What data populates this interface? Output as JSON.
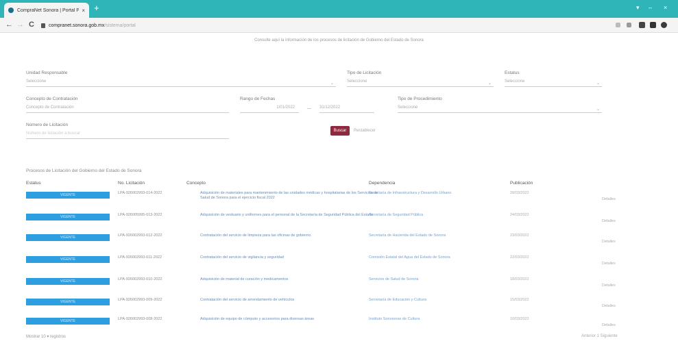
{
  "browser": {
    "tab_title": "CompraNet Sonora | Portal Públ",
    "tab_close": "×",
    "new_tab": "+",
    "win_min": "▾",
    "win_restore": "–",
    "win_close": "×",
    "back": "←",
    "forward": "→",
    "reload": "C",
    "url_host": "compranet.sonora.gob.mx",
    "url_path": "/sistema/portal"
  },
  "page": {
    "banner": "Consulte aquí la información de los procesos de licitación de Gobierno del Estado de Sonora"
  },
  "filters": {
    "unidad_label": "Unidad Responsable",
    "unidad_value": "Seleccione",
    "tipo_label": "Tipo de Licitación",
    "tipo_value": "Seleccione",
    "estatus_label": "Estatus",
    "estatus_value": "Seleccione",
    "concepto_label": "Concepto de Contratación",
    "concepto_value": "Concepto de Contratación",
    "rango_label": "Rango de Fechas",
    "fecha_inicio": "1/01/2022",
    "fecha_fin": "31/12/2022",
    "fecha_sep": "—",
    "tipo_proc_label": "Tipo de Procedimiento",
    "tipo_proc_value": "Seleccione",
    "numero_label": "Número de Licitación",
    "numero_placeholder": "Número de licitación a buscar",
    "buscar": "Buscar",
    "restablecer": "Restablecer",
    "chevron": "⌄"
  },
  "table": {
    "summary": "Procesos de Licitación del Gobierno del Estado de Sonora",
    "headers": [
      "Estatus",
      "No. Licitación",
      "Concepto",
      "Dependencia",
      "Publicación"
    ],
    "detail_label": "Detalles",
    "rows": [
      {
        "status": "VIGENTE",
        "numero": "LPA-926002993-014-2022",
        "concepto": "Adquisición de materiales para mantenimiento de las unidades médicas y hospitalarias de los Servicios de Salud de Sonora para el ejercicio fiscal 2022",
        "dependencia": "Secretaría de Infraestructura y Desarrollo Urbano",
        "fecha": "28/03/2022"
      },
      {
        "status": "VIGENTE",
        "numero": "LPA-926005995-013-2022",
        "concepto": "Adquisición de vestuario y uniformes para el personal de la Secretaría de Seguridad Pública del Estado",
        "dependencia": "Secretaría de Seguridad Pública",
        "fecha": "24/03/2022"
      },
      {
        "status": "VIGENTE",
        "numero": "LPA-926002993-012-2022",
        "concepto": "Contratación del servicio de limpieza para las oficinas de gobierno",
        "dependencia": "Secretaría de Hacienda del Estado de Sonora",
        "fecha": "23/03/2022"
      },
      {
        "status": "VIGENTE",
        "numero": "LPA-926002993-011-2022",
        "concepto": "Contratación del servicio de vigilancia y seguridad",
        "dependencia": "Comisión Estatal del Agua del Estado de Sonora",
        "fecha": "22/03/2022"
      },
      {
        "status": "VIGENTE",
        "numero": "LPA-926002993-010-2022",
        "concepto": "Adquisición de material de curación y medicamentos",
        "dependencia": "Servicios de Salud de Sonora",
        "fecha": "18/03/2022"
      },
      {
        "status": "VIGENTE",
        "numero": "LPA-926002993-009-2022",
        "concepto": "Contratación del servicio de arrendamiento de vehículos",
        "dependencia": "Secretaría de Educación y Cultura",
        "fecha": "15/03/2022"
      },
      {
        "status": "VIGENTE",
        "numero": "LPA-926002993-008-2022",
        "concepto": "Adquisición de equipo de cómputo y accesorios para diversas áreas",
        "dependencia": "Instituto Sonorense de Cultura",
        "fecha": "10/03/2022"
      }
    ]
  },
  "footer": {
    "showing": "Mostrar 10 ▾ registros",
    "pagination": "Anterior  1  Siguiente"
  },
  "colors": {
    "tabbar": "#2fb4b8",
    "badge": "#2d9ee0",
    "buscar": "#8c2b3e"
  }
}
